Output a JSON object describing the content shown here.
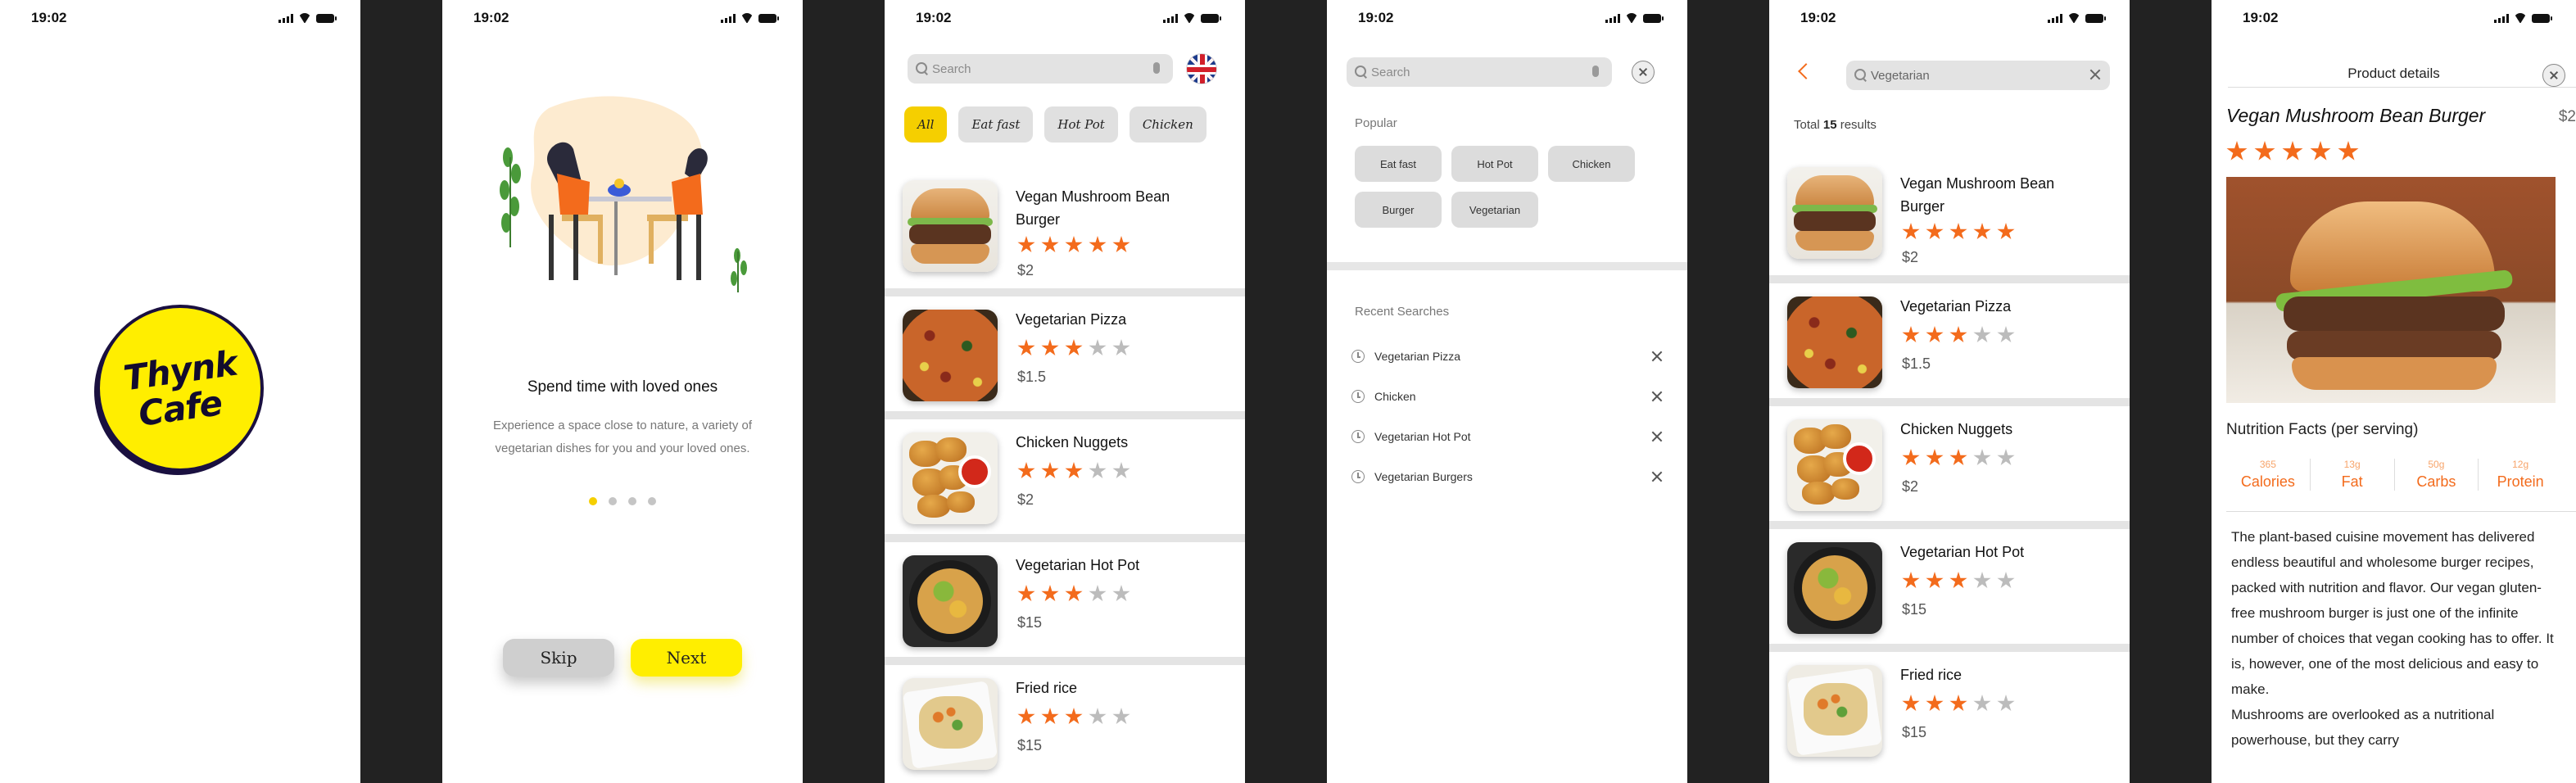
{
  "status": {
    "time": "19:02"
  },
  "splash": {
    "logo_line1": "Thynk",
    "logo_line2": "Cafe"
  },
  "onboarding": {
    "title": "Spend time with loved ones",
    "description": "Experience a space close to nature, a variety of vegetarian dishes for you and your loved ones.",
    "page_index": 1,
    "page_count": 4,
    "skip_label": "Skip",
    "next_label": "Next"
  },
  "home": {
    "search_placeholder": "Search",
    "chips": [
      "All",
      "Eat fast",
      "Hot Pot",
      "Chicken"
    ],
    "active_chip": "All",
    "items": [
      {
        "name": "Vegan Mushroom Bean Burger",
        "rating": 5,
        "price": "$2",
        "image": "burger"
      },
      {
        "name": "Vegetarian Pizza",
        "rating": 3,
        "price": "$1.5",
        "image": "pizza"
      },
      {
        "name": "Chicken Nuggets",
        "rating": 3,
        "price": "$2",
        "image": "nuggets"
      },
      {
        "name": "Vegetarian Hot Pot",
        "rating": 3,
        "price": "$15",
        "image": "hotpot"
      },
      {
        "name": "Fried rice",
        "rating": 3,
        "price": "$15",
        "image": "rice"
      }
    ]
  },
  "search_screen": {
    "placeholder": "Search",
    "popular_label": "Popular",
    "popular": [
      "Eat fast",
      "Hot Pot",
      "Chicken",
      "Burger",
      "Vegetarian"
    ],
    "recent_label": "Recent Searches",
    "recent": [
      "Vegetarian Pizza",
      "Chicken",
      "Vegetarian Hot Pot",
      "Vegetarian Burgers"
    ]
  },
  "results": {
    "query": "Vegetarian",
    "total_prefix": "Total",
    "total_count": "15",
    "total_suffix": "results",
    "items": [
      {
        "name": "Vegan Mushroom Bean Burger",
        "rating": 5,
        "price": "$2",
        "image": "burger"
      },
      {
        "name": "Vegetarian Pizza",
        "rating": 3,
        "price": "$1.5",
        "image": "pizza"
      },
      {
        "name": "Chicken Nuggets",
        "rating": 3,
        "price": "$2",
        "image": "nuggets"
      },
      {
        "name": "Vegetarian Hot Pot",
        "rating": 3,
        "price": "$15",
        "image": "hotpot"
      },
      {
        "name": "Fried rice",
        "rating": 3,
        "price": "$15",
        "image": "rice"
      }
    ]
  },
  "product": {
    "header": "Product details",
    "name": "Vegan Mushroom Bean Burger",
    "price": "$2",
    "rating": 5,
    "nutrition_title": "Nutrition Facts (per serving)",
    "nutrition": [
      {
        "value": "365",
        "label": "Calories"
      },
      {
        "value": "13g",
        "label": "Fat"
      },
      {
        "value": "50g",
        "label": "Carbs"
      },
      {
        "value": "12g",
        "label": "Protein"
      }
    ],
    "description": "The plant-based cuisine movement has delivered endless beautiful and wholesome burger recipes, packed with nutrition and flavor. Our vegan gluten-free mushroom burger is just one of the infinite number of choices that vegan cooking has to offer. It is, however, one of the most delicious and easy to make.",
    "description2": "Mushrooms are overlooked as a nutritional powerhouse, but they carry"
  },
  "colors": {
    "accent": "#f36b1c",
    "yellow": "#ffee00",
    "chip_active": "#f5cf00"
  }
}
